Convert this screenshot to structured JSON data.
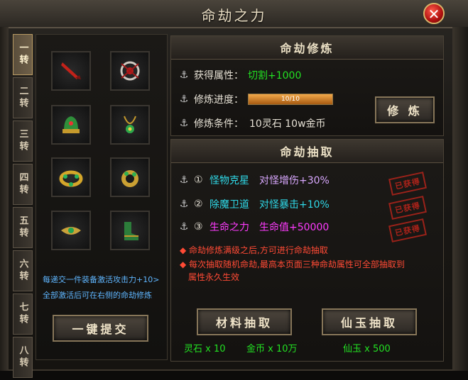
{
  "window": {
    "title": "命劫之力",
    "close_glyph": "✕"
  },
  "tabs": [
    "一转",
    "二转",
    "三转",
    "四转",
    "五转",
    "六转",
    "七转",
    "八转"
  ],
  "left": {
    "hint1": "每递交一件装备激活攻击力+10>",
    "hint2": "全部激活后可在右侧的命劫修炼",
    "submit_button": "一键提交"
  },
  "cultivate": {
    "header": "命劫修炼",
    "attr_label": "获得属性：",
    "attr_value": "切割+1000",
    "progress_label": "修炼进度：",
    "progress_text": "10/10",
    "progress_fraction": 1.0,
    "cond_label": "修炼条件：",
    "cond_value": "10灵石  10w金币",
    "button": "修 炼"
  },
  "draw": {
    "header": "命劫抽取",
    "rows": [
      {
        "num": "①",
        "name": "怪物克星",
        "effect": "对怪增伤+30%",
        "stamp": "已获得"
      },
      {
        "num": "②",
        "name": "除魔卫道",
        "effect": "对怪暴击+10%",
        "stamp": "已获得"
      },
      {
        "num": "③",
        "name": "生命之力",
        "effect": "生命值+50000",
        "stamp": "已获得"
      }
    ],
    "note1": "命劫修炼满级之后,方可进行命劫抽取",
    "note2a": "每次抽取随机命劫,最高本页面三种命劫属性可全部抽取到",
    "note2b": "属性永久生效",
    "material_button": "材料抽取",
    "jade_button": "仙玉抽取",
    "lingshi": "灵石 x 10",
    "gold": "金币 x 10万",
    "jade": "仙玉 x 500"
  },
  "colors": {
    "accent_green": "#22e022",
    "stamp_red": "#c8251b",
    "hint_blue": "#5fb6ff"
  }
}
